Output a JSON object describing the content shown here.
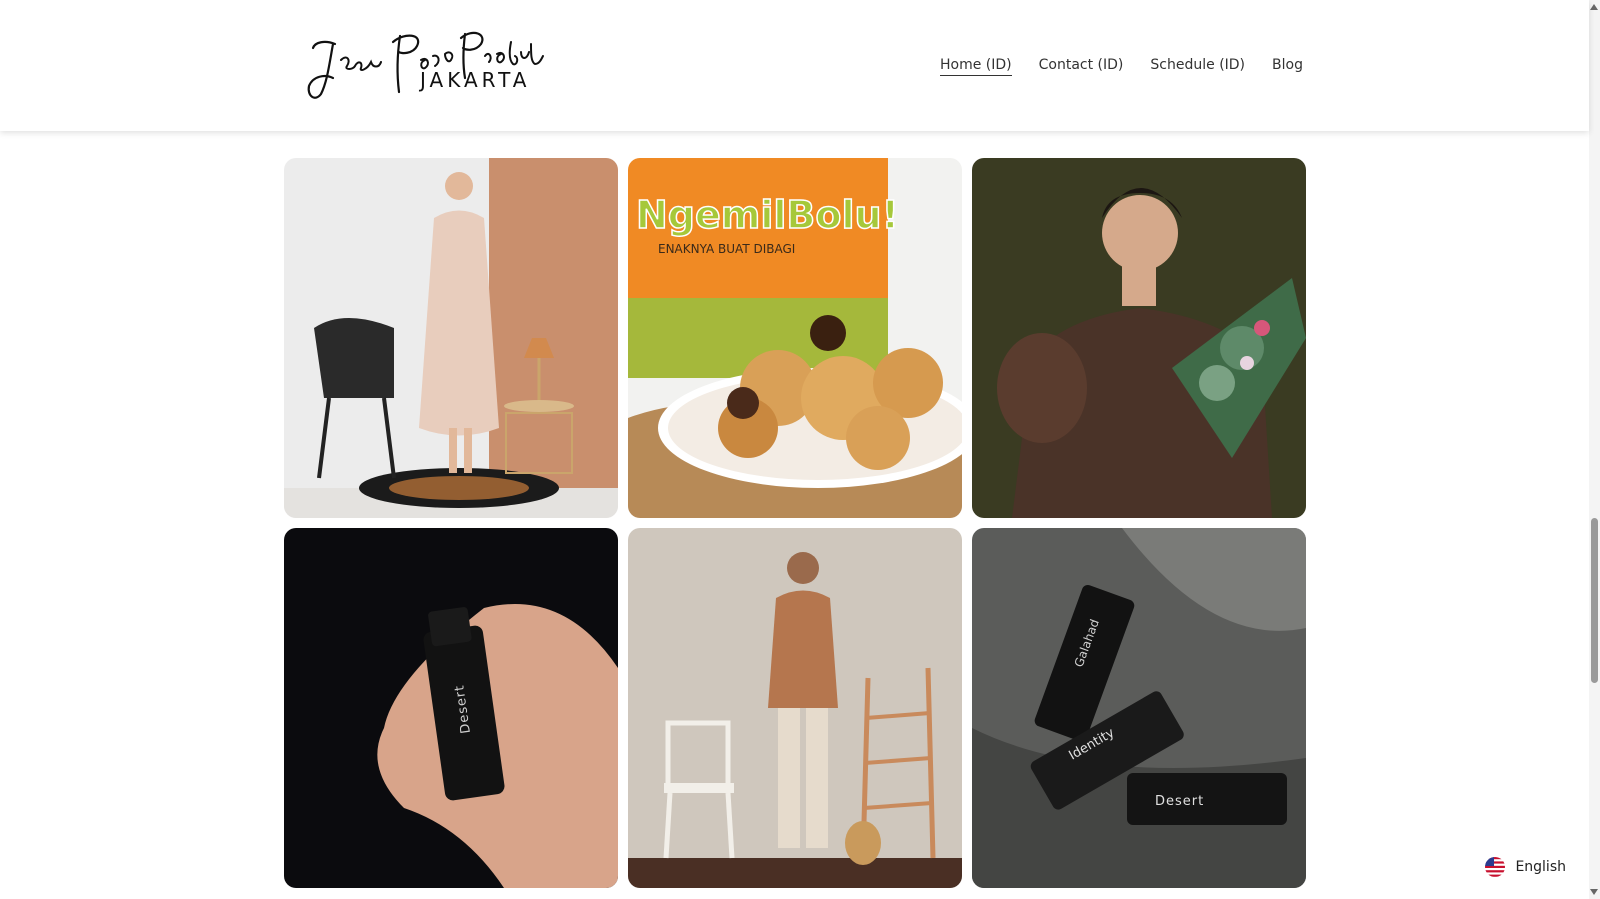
{
  "header": {
    "logo": {
      "script_text": "Jasa Foto Produk",
      "sub_text": "JAKARTA"
    },
    "nav": [
      {
        "label": "Home (ID)",
        "active": true
      },
      {
        "label": "Contact (ID)",
        "active": false
      },
      {
        "label": "Schedule (ID)",
        "active": false
      },
      {
        "label": "Blog",
        "active": false
      }
    ]
  },
  "gallery": {
    "images": [
      {
        "subject": "woman-in-dress-with-chair",
        "text": ""
      },
      {
        "subject": "ngemil-bolu-pastries",
        "text": "NgemilBolu!",
        "subtext": "ENAKNYA BUAT DIBAGI"
      },
      {
        "subject": "woman-with-flowers",
        "text": ""
      },
      {
        "subject": "hand-holding-perfume",
        "text": "Desert"
      },
      {
        "subject": "man-with-chair-and-ladder",
        "text": ""
      },
      {
        "subject": "perfume-bottles",
        "texts": [
          "Galahad",
          "Identity",
          "Desert"
        ]
      }
    ]
  },
  "language": {
    "label": "English",
    "icon": "us-flag-icon"
  },
  "colors": {
    "accent_orange": "#f08a24",
    "text": "#333333"
  }
}
